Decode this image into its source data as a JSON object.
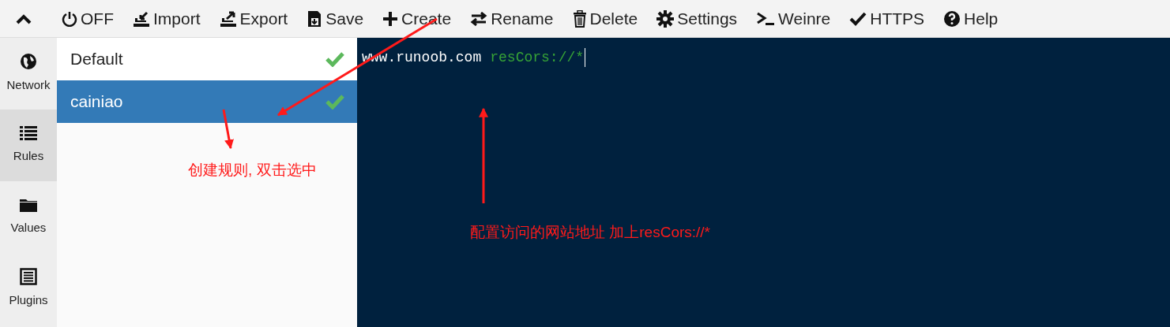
{
  "toolbar": [
    {
      "kind": "collapse"
    },
    {
      "kind": "power",
      "label": "OFF"
    },
    {
      "kind": "import",
      "label": "Import"
    },
    {
      "kind": "export",
      "label": "Export"
    },
    {
      "kind": "save",
      "label": "Save"
    },
    {
      "kind": "create",
      "label": "Create"
    },
    {
      "kind": "rename",
      "label": "Rename"
    },
    {
      "kind": "delete",
      "label": "Delete"
    },
    {
      "kind": "settings",
      "label": "Settings"
    },
    {
      "kind": "weinre",
      "label": "Weinre"
    },
    {
      "kind": "https",
      "label": "HTTPS"
    },
    {
      "kind": "help",
      "label": "Help"
    }
  ],
  "sidebar": {
    "items": [
      {
        "kind": "network",
        "label": "Network",
        "selected": false
      },
      {
        "kind": "rules",
        "label": "Rules",
        "selected": true
      },
      {
        "kind": "values",
        "label": "Values",
        "selected": false
      },
      {
        "kind": "plugins",
        "label": "Plugins",
        "selected": false
      }
    ]
  },
  "rules": [
    {
      "name": "Default",
      "selected": false,
      "checked": true
    },
    {
      "name": "cainiao",
      "selected": true,
      "checked": true
    }
  ],
  "editor": {
    "lines": [
      {
        "tokens": [
          {
            "kind": "host",
            "text": "www.runoob.com"
          },
          {
            "kind": "protocol",
            "text": "resCors://*"
          }
        ]
      }
    ]
  },
  "annotations": [
    {
      "kind": "left",
      "text": "创建规则, 双击选中"
    },
    {
      "kind": "right",
      "text": "配置访问的网站地址 加上resCors://*"
    }
  ]
}
